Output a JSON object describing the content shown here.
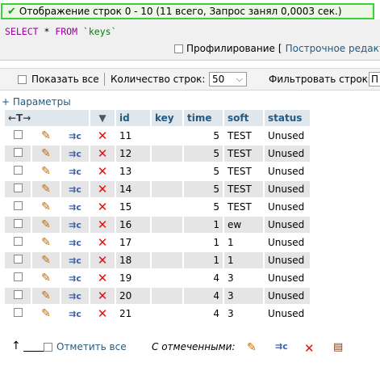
{
  "banner": {
    "icon": "check-icon",
    "message": "Отображение строк 0 - 10 (11 всего, Запрос занял 0,0003 сек.)"
  },
  "sql": {
    "kw1": "SELECT",
    "star": " * ",
    "kw2": "FROM",
    "table": " `keys`"
  },
  "profiling": {
    "label": "Профилирование",
    "bracket": "[",
    "link": "Построчное редакти"
  },
  "nav": {
    "show_all": "Показать все",
    "rows_label": "Количество строк:",
    "rows_value": "50",
    "filter_label": "Фильтровать строки:",
    "filter_value": "П"
  },
  "params_link": "+ Параметры",
  "table": {
    "headers": {
      "arrows": "←T→",
      "sort": "▼",
      "id": "id",
      "key": "key",
      "time": "time",
      "soft": "soft",
      "status": "status"
    },
    "rows": [
      {
        "id": "11",
        "key": "",
        "time": "5",
        "soft": "TEST",
        "status": "Unused"
      },
      {
        "id": "12",
        "key": "",
        "time": "5",
        "soft": "TEST",
        "status": "Unused"
      },
      {
        "id": "13",
        "key": "",
        "time": "5",
        "soft": "TEST",
        "status": "Unused"
      },
      {
        "id": "14",
        "key": "",
        "time": "5",
        "soft": "TEST",
        "status": "Unused"
      },
      {
        "id": "15",
        "key": "",
        "time": "5",
        "soft": "TEST",
        "status": "Unused"
      },
      {
        "id": "16",
        "key": "",
        "time": "1",
        "soft": "ew",
        "status": "Unused"
      },
      {
        "id": "17",
        "key": "",
        "time": "1",
        "soft": "1",
        "status": "Unused"
      },
      {
        "id": "18",
        "key": "",
        "time": "1",
        "soft": "1",
        "status": "Unused"
      },
      {
        "id": "19",
        "key": "",
        "time": "4",
        "soft": "3",
        "status": "Unused"
      },
      {
        "id": "20",
        "key": "",
        "time": "4",
        "soft": "3",
        "status": "Unused"
      },
      {
        "id": "21",
        "key": "",
        "time": "4",
        "soft": "3",
        "status": "Unused"
      }
    ]
  },
  "footer": {
    "check_all": "Отметить все",
    "with_selected": "С отмеченными:"
  },
  "icons": {
    "edit": "pencil-icon",
    "copy": "copy-icon",
    "delete": "delete-icon",
    "export": "export-icon"
  },
  "colors": {
    "link": "#235a81",
    "header_bg": "#dfe6ec",
    "banner_border": "#3bd13b"
  }
}
